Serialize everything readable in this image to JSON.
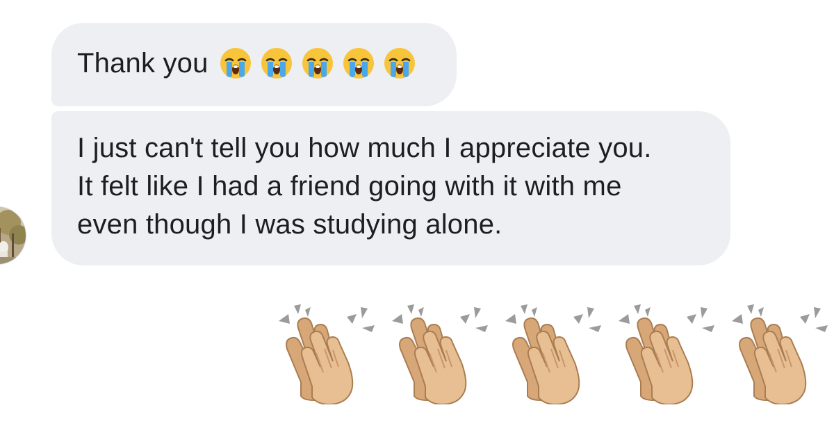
{
  "conversation": {
    "messages": [
      {
        "text": "Thank you",
        "emoji": "😭😭😭😭😭",
        "emoji_icon": "loudly-crying-face-icon",
        "emoji_count": 5
      },
      {
        "lines": [
          "I just can't tell you how much I appreciate you.",
          "It felt like I had a friend going with it with me",
          "even though I was studying alone."
        ]
      }
    ],
    "reaction": {
      "emoji": "👏🏼👏🏼👏🏼👏🏼👏🏼",
      "emoji_icon": "clapping-hands-icon",
      "emoji_count": 5
    }
  },
  "colors": {
    "bubble_background": "#edeff2",
    "message_text": "#1c1e21",
    "page_background": "#ffffff",
    "skin_tone": "#e8bf93"
  }
}
